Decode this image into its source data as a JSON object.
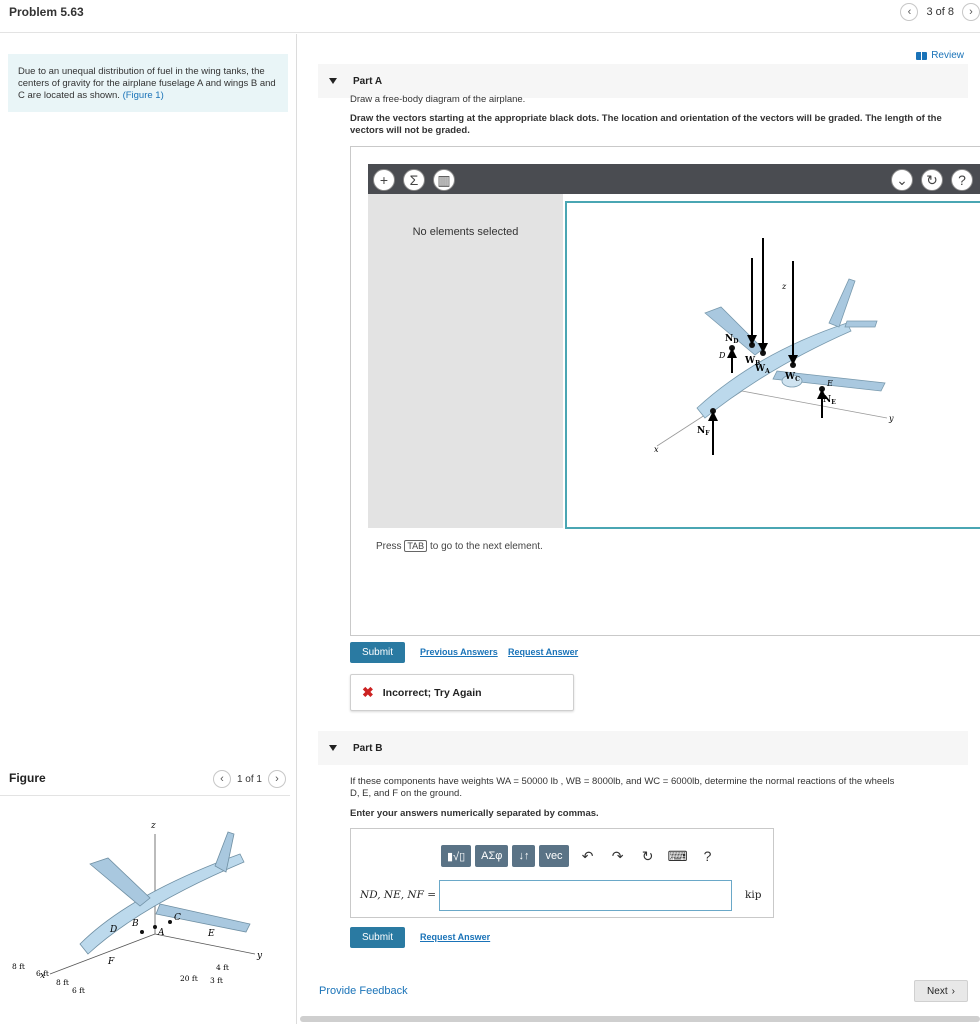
{
  "header": {
    "title": "Problem 5.63",
    "pager_text": "3 of 8"
  },
  "problem": {
    "statement_prefix": "Due to an unequal distribution of fuel in the wing tanks, the centers of gravity for the airplane fuselage A and wings B and C are located as shown.",
    "figure_link": "(Figure 1)"
  },
  "figure": {
    "label": "Figure",
    "pager_text": "1 of 1"
  },
  "review": {
    "label": "Review"
  },
  "partA": {
    "title": "Part A",
    "instruction": "Draw a free-body diagram of the airplane.",
    "bold_instruction": "Draw the vectors starting at the appropriate black dots. The location and orientation of the vectors will be graded. The length of the vectors will not be graded.",
    "no_elements": "No elements selected",
    "press_prefix": "Press",
    "press_key": "TAB",
    "press_suffix": "to go to the next element.",
    "submit": "Submit",
    "previous_answers": "Previous Answers",
    "request_answer": "Request Answer",
    "incorrect": "Incorrect; Try Again"
  },
  "diagram_labels": {
    "ND": "N",
    "ND_sub": "D",
    "WB": "W",
    "WB_sub": "B",
    "WA": "W",
    "WA_sub": "A",
    "WC": "W",
    "WC_sub": "C",
    "NE": "N",
    "NE_sub": "E",
    "NF": "N",
    "NF_sub": "F",
    "D": "D",
    "E": "E",
    "x": "x",
    "y": "y",
    "z": "z"
  },
  "figure_labels": {
    "z": "z",
    "x": "x",
    "y": "y",
    "B": "B",
    "A": "A",
    "C": "C",
    "D": "D",
    "E": "E",
    "F": "F",
    "d1": "8 ft",
    "d2": "6 ft",
    "d3": "8 ft",
    "d4": "6 ft",
    "d5": "20 ft",
    "d6": "4 ft",
    "d7": "3 ft"
  },
  "partB": {
    "title": "Part B",
    "question_line1": "If these components have weights WA = 50000 lb , WB = 8000lb, and WC = 6000lb, determine the normal reactions of the wheels",
    "question_line2": "D, E, and F on the ground.",
    "instruction": "Enter your answers numerically separated by commas.",
    "toolbar": {
      "templates": "▮√▯",
      "greek": "ΑΣφ",
      "arrows": "↓↑",
      "vec": "vec",
      "help": "?"
    },
    "answer_label": "ND, NE, NF =",
    "unit": "kip",
    "submit": "Submit",
    "request_answer": "Request Answer"
  },
  "footer": {
    "feedback": "Provide Feedback",
    "next": "Next"
  }
}
